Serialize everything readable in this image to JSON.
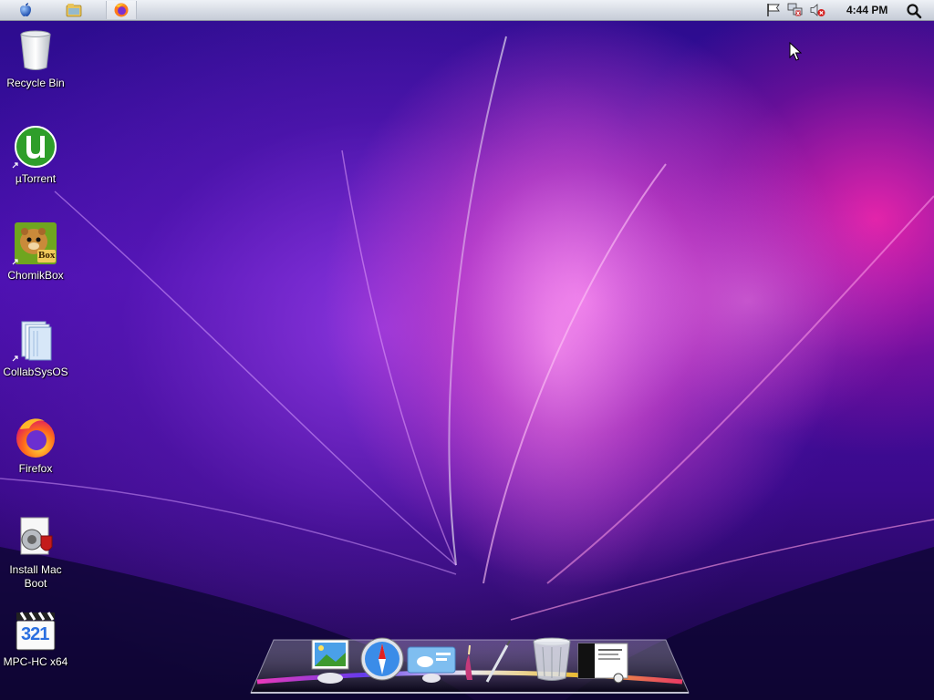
{
  "menubar": {
    "apple_icon": "apple-logo-icon",
    "pinned": [
      "explorer-icon",
      "firefox-icon"
    ],
    "tray": [
      "action-center-flag-icon",
      "network-icon",
      "volume-muted-icon"
    ],
    "clock": "4:44 PM",
    "search_icon": "search-icon"
  },
  "desktop_icons": [
    {
      "label": "Recycle Bin",
      "icon": "recycle-bin-icon"
    },
    {
      "label": "µTorrent",
      "icon": "utorrent-icon"
    },
    {
      "label": "ChomikBox",
      "icon": "chomikbox-icon",
      "badge": "Box"
    },
    {
      "label": "CollabSysOS",
      "icon": "folder-icon"
    },
    {
      "label": "Firefox",
      "icon": "firefox-icon"
    },
    {
      "label": "Install Mac Boot",
      "icon": "installer-icon"
    },
    {
      "label": "MPC-HC x64",
      "icon": "mpc-hc-icon",
      "badge": "321"
    }
  ],
  "dock": {
    "items": [
      "preview-icon",
      "safari-icon",
      "weather-icon",
      "brush-icon",
      "trash-icon",
      "window-thumbnail-icon"
    ]
  },
  "colors": {
    "accent_pink": "#ff3cc8",
    "wallpaper_base": "#3a0a8a",
    "utorrent_green": "#2e9e2a"
  }
}
